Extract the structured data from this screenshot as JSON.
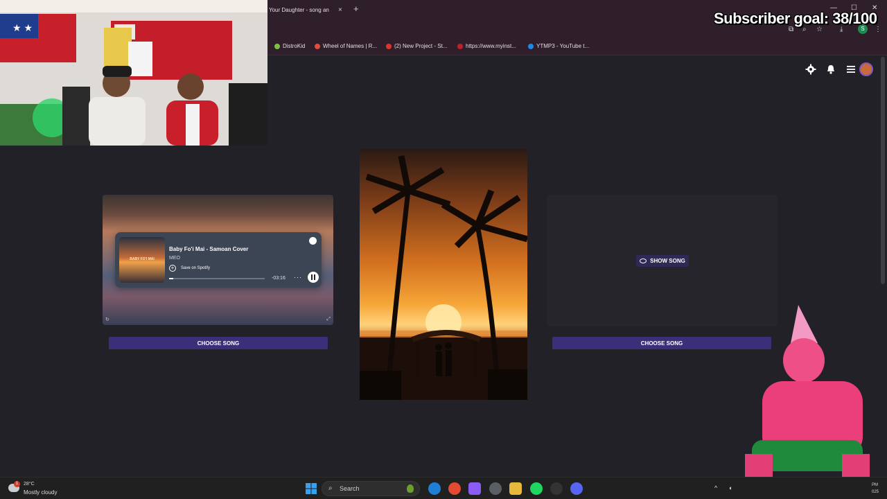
{
  "browser": {
    "tab_title": "Your Daughter - song an",
    "tab_close": "×",
    "new_tab": "+",
    "bookmarks": [
      {
        "label": "DistroKid",
        "color": "#7ac143"
      },
      {
        "label": "Wheel of Names | R...",
        "color": "#e14c3c"
      },
      {
        "label": "(2) New Project - St...",
        "color": "#e0322e"
      },
      {
        "label": "https://www.myinst...",
        "color": "#c0202a"
      },
      {
        "label": "YTMP3 - YouTube t...",
        "color": "#1e88e5"
      }
    ],
    "profile_initial": "S"
  },
  "stream_overlay": {
    "subscriber_goal": "Subscriber goal: 38/100"
  },
  "left_card": {
    "player": {
      "song_title": "Baby Fo'i Mai - Samoan Cover",
      "artist": "MEO",
      "save_label": "Save on Spotify",
      "time_remaining": "-03:16",
      "more_label": "···",
      "album_art_title": "BABY FO'I MAI",
      "progress": 0.04
    },
    "choose_label": "CHOOSE SONG"
  },
  "right_card": {
    "show_label": "SHOW SONG",
    "choose_label": "CHOOSE SONG"
  },
  "icons": {
    "settings": "gear-icon",
    "notifications": "bell-icon",
    "menu": "hamburger-icon",
    "accent": "#3b2f7a"
  },
  "taskbar": {
    "weather_temp": "28°C",
    "weather_desc": "Mostly cloudy",
    "weather_badge": "1",
    "search_label": "Search",
    "tray_time": "PM",
    "tray_date": "025"
  }
}
